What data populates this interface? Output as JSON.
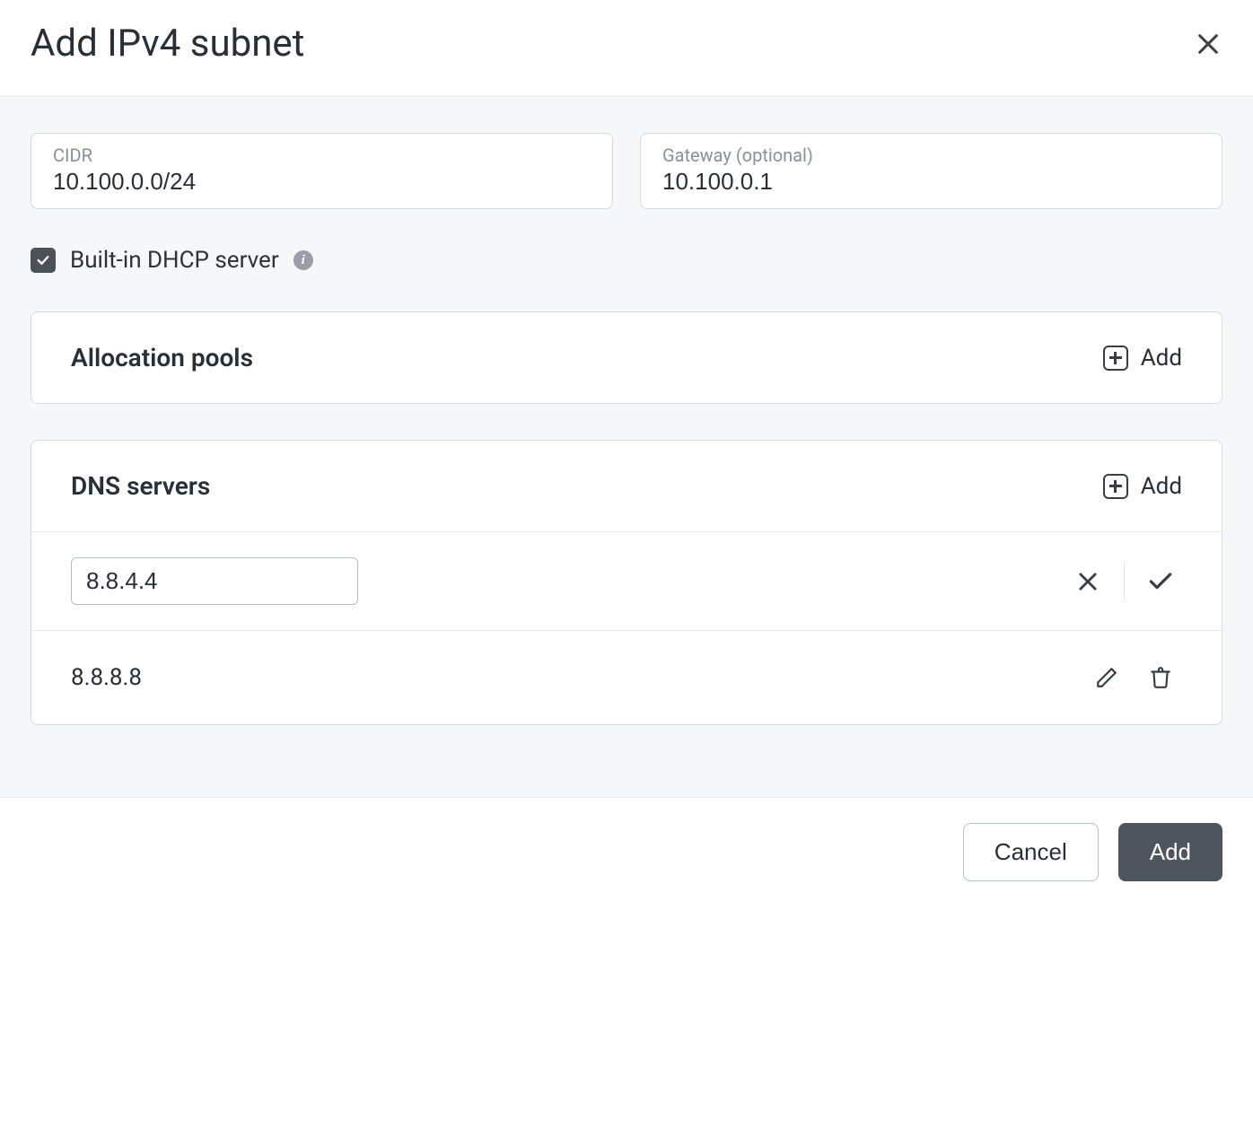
{
  "dialog": {
    "title": "Add IPv4 subnet"
  },
  "cidr": {
    "label": "CIDR",
    "value": "10.100.0.0/24"
  },
  "gateway": {
    "label": "Gateway (optional)",
    "value": "10.100.0.1"
  },
  "dhcp": {
    "label": "Built-in DHCP server",
    "checked": true
  },
  "allocation_pools": {
    "title": "Allocation pools",
    "add_label": "Add"
  },
  "dns_servers": {
    "title": "DNS servers",
    "add_label": "Add",
    "editing_value": "8.8.4.4",
    "static_value": "8.8.8.8"
  },
  "footer": {
    "cancel_label": "Cancel",
    "add_label": "Add"
  }
}
